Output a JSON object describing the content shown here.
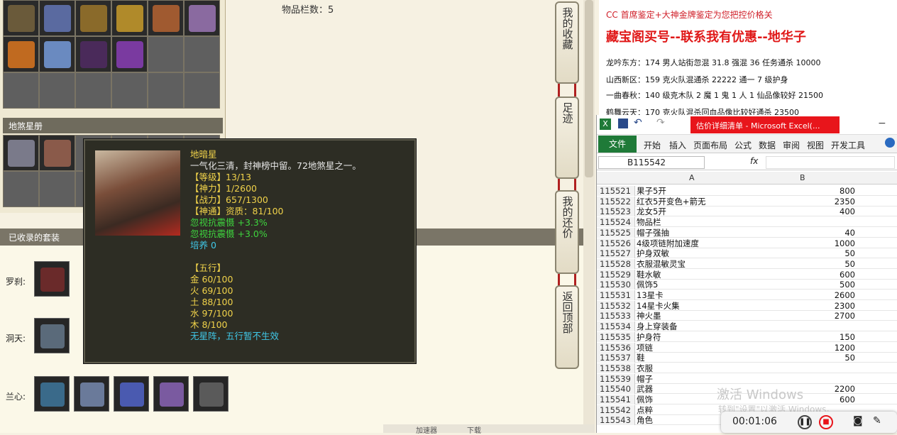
{
  "inventory": {
    "count_label": "物品栏数：5"
  },
  "star_book": {
    "header": "地煞星册"
  },
  "suits": {
    "header": "已收录的套装",
    "labels": [
      "罗刹:",
      "洞天:",
      "兰心:"
    ]
  },
  "tooltip": {
    "name": "地暗星",
    "desc": "一气化三清，封神榜中留。72地煞星之一。",
    "level": "【等级】13/13",
    "spirit": "【神力】1/2600",
    "power": "【战力】657/1300",
    "shentong": "【神通】资质：81/100",
    "buff1": "忽视抗震慑 +3.3%",
    "buff2": "忽视抗震慑 +3.0%",
    "cultivate": "培养 0",
    "wuxing_title": "【五行】",
    "metal": "金 60/100",
    "fire": "火 69/100",
    "earth": "土 88/100",
    "water": "水 97/100",
    "wood": "木 8/100",
    "note": "无星阵，五行暂不生效"
  },
  "side_buttons": [
    "我的收藏",
    "足迹",
    "我的还价",
    "返回顶部"
  ],
  "doc": {
    "line0": "CC 首席鉴定+大神金牌鉴定为您把控价格关",
    "headline": "藏宝阁买号--联系我有优惠--地华子",
    "line1": "龙吟东方：174 男人站街忽混 31.8 强混 36 任务通杀 10000",
    "line2": "山西新区：159 克火队混通杀 22222 通一 7 级护身",
    "line3": "一曲春秋：140 级克木队 2 魔 1 鬼 1 人 1 仙品像较好 21500",
    "line4": "鹤舞云天：170 克火队混杀回血品像比较好通杀 23500"
  },
  "excel": {
    "title": "估价详细清单 - Microsoft Excel(...",
    "file_tab": "文件",
    "tabs": [
      "开始",
      "插入",
      "页面布局",
      "公式",
      "数据",
      "审阅",
      "视图",
      "开发工具"
    ],
    "namebox": "B115542",
    "fx": "fx",
    "col_a": "A",
    "col_b": "B",
    "rows": [
      {
        "n": "115521",
        "a": "果子5开",
        "b": "800"
      },
      {
        "n": "115522",
        "a": "红衣5开变色+箭无",
        "b": "2350"
      },
      {
        "n": "115523",
        "a": "龙女5开",
        "b": "400"
      },
      {
        "n": "115524",
        "a": "物品栏",
        "b": ""
      },
      {
        "n": "115525",
        "a": "帽子强抽",
        "b": "40"
      },
      {
        "n": "115526",
        "a": "4级项链附加速度",
        "b": "1000"
      },
      {
        "n": "115527",
        "a": "护身双敏",
        "b": "50"
      },
      {
        "n": "115528",
        "a": "衣服混敏灵宝",
        "b": "50"
      },
      {
        "n": "115529",
        "a": "鞋水敏",
        "b": "600"
      },
      {
        "n": "115530",
        "a": "佩饰5",
        "b": "500"
      },
      {
        "n": "115531",
        "a": "13星卡",
        "b": "2600"
      },
      {
        "n": "115532",
        "a": "14星卡火集",
        "b": "2300"
      },
      {
        "n": "115533",
        "a": "神火墨",
        "b": "2700"
      },
      {
        "n": "115534",
        "a": "身上穿装备",
        "b": ""
      },
      {
        "n": "115535",
        "a": "护身符",
        "b": "150"
      },
      {
        "n": "115536",
        "a": "项链",
        "b": "1200"
      },
      {
        "n": "115537",
        "a": "鞋",
        "b": "50"
      },
      {
        "n": "115538",
        "a": "衣服",
        "b": ""
      },
      {
        "n": "115539",
        "a": "帽子",
        "b": ""
      },
      {
        "n": "115540",
        "a": "武器",
        "b": "2200"
      },
      {
        "n": "115541",
        "a": "佩饰",
        "b": "600"
      },
      {
        "n": "115542",
        "a": "点粹",
        "b": ""
      },
      {
        "n": "115543",
        "a": "角色",
        "b": ""
      }
    ]
  },
  "watermark": {
    "line1": "激活 Windows",
    "line2": "转到\"设置\"以激活 Windows。"
  },
  "recorder": {
    "time": "00:01:06"
  },
  "status": {
    "speed": "加速器",
    "download": "下载"
  },
  "colors": {
    "accent_red": "#e8151b",
    "excel_green": "#1f7a38",
    "tooltip_bg": "#2d2d24"
  }
}
